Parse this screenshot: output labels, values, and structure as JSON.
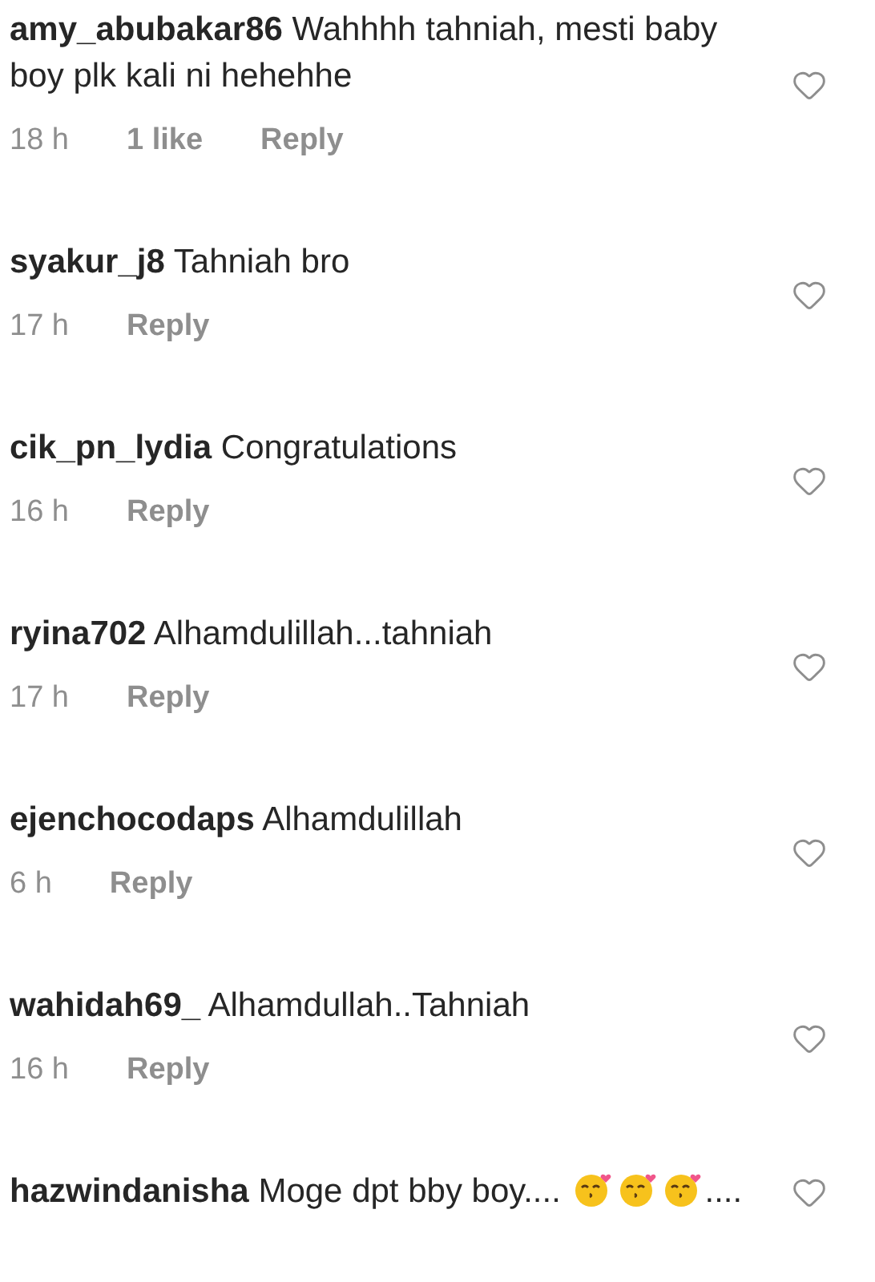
{
  "comments": [
    {
      "username": "amy_abubakar86",
      "text": [
        {
          "kind": "text",
          "value": "Wahhhh tahniah, mesti baby boy plk kali ni hehehhe"
        }
      ],
      "time": "18 h",
      "likes": "1 like",
      "reply": "Reply"
    },
    {
      "username": "syakur_j8",
      "text": [
        {
          "kind": "text",
          "value": "Tahniah bro"
        }
      ],
      "time": "17 h",
      "reply": "Reply"
    },
    {
      "username": "cik_pn_lydia",
      "text": [
        {
          "kind": "text",
          "value": "Congratulations"
        }
      ],
      "time": "16 h",
      "reply": "Reply"
    },
    {
      "username": "ryina702",
      "text": [
        {
          "kind": "text",
          "value": "Alhamdulillah...tahniah"
        }
      ],
      "time": "17 h",
      "reply": "Reply"
    },
    {
      "username": "ejenchocodaps",
      "text": [
        {
          "kind": "text",
          "value": "Alhamdulillah"
        }
      ],
      "time": "6 h",
      "reply": "Reply"
    },
    {
      "username": "wahidah69_",
      "text": [
        {
          "kind": "text",
          "value": "Alhamdullah..Tahniah"
        }
      ],
      "time": "16 h",
      "reply": "Reply"
    },
    {
      "username": "hazwindanisha",
      "text": [
        {
          "kind": "text",
          "value": "Moge dpt bby boy.... "
        },
        {
          "kind": "emoji"
        },
        {
          "kind": "emoji"
        },
        {
          "kind": "emoji"
        },
        {
          "kind": "text",
          "value": "...."
        }
      ]
    }
  ]
}
